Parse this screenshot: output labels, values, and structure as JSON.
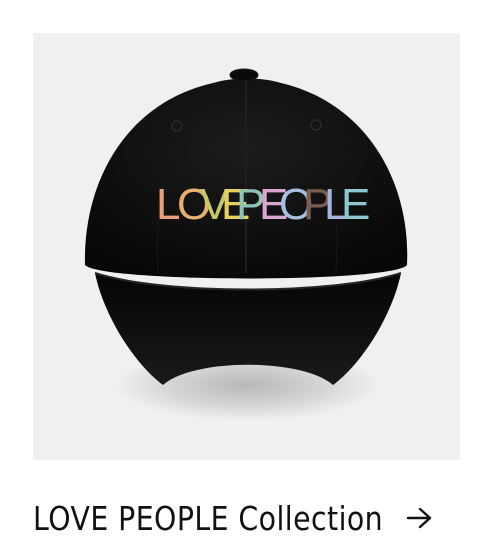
{
  "card": {
    "image_text": "LOVE PEOPLE",
    "collection_label": "LOVE PEOPLE Collection",
    "arrow_icon": "arrow-right-icon"
  },
  "colors": {
    "background": "#ffffff",
    "image_background": "#f0f0f0",
    "cap": "#0d0d0d",
    "text": "#111111",
    "embroidery": [
      "#e8a17a",
      "#e59f6b",
      "#b9c86a",
      "#e7cf5e",
      "#8fc2b7",
      "#d9a7d0",
      "#a5bfe0",
      "#7a5d4e",
      "#a8b4e0",
      "#89c9cf"
    ]
  }
}
